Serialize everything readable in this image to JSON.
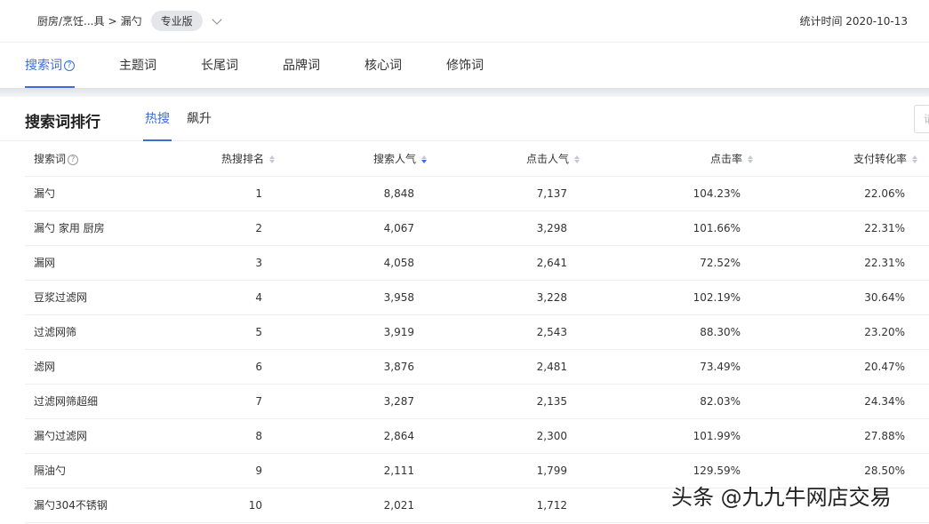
{
  "header": {
    "breadcrumb_category": "厨房/烹饪...具",
    "breadcrumb_sep": ">",
    "breadcrumb_item": "漏勺",
    "badge": "专业版",
    "stat_time": "统计时间 2020-10-13"
  },
  "tabs": [
    {
      "label": "搜索词",
      "active": true,
      "help": "?"
    },
    {
      "label": "主题词"
    },
    {
      "label": "长尾词"
    },
    {
      "label": "品牌词"
    },
    {
      "label": "核心词"
    },
    {
      "label": "修饰词"
    }
  ],
  "ranking": {
    "title": "搜索词排行",
    "subtabs": [
      "热搜",
      "飙升"
    ],
    "search_placeholder": "请"
  },
  "table": {
    "columns": [
      "搜索词",
      "热搜排名",
      "搜索人气",
      "点击人气",
      "点击率",
      "支付转化率"
    ],
    "column_help": "?",
    "rows": [
      [
        "漏勺",
        "1",
        "8,848",
        "7,137",
        "104.23%",
        "22.06%"
      ],
      [
        "漏勺 家用 厨房",
        "2",
        "4,067",
        "3,298",
        "101.66%",
        "22.31%"
      ],
      [
        "漏网",
        "3",
        "4,058",
        "2,641",
        "72.52%",
        "22.31%"
      ],
      [
        "豆浆过滤网",
        "4",
        "3,958",
        "3,228",
        "102.19%",
        "30.64%"
      ],
      [
        "过滤网筛",
        "5",
        "3,919",
        "2,543",
        "88.30%",
        "23.20%"
      ],
      [
        "滤网",
        "6",
        "3,876",
        "2,481",
        "73.49%",
        "20.47%"
      ],
      [
        "过滤网筛超细",
        "7",
        "3,287",
        "2,135",
        "82.03%",
        "24.34%"
      ],
      [
        "漏勺过滤网",
        "8",
        "2,864",
        "2,300",
        "101.99%",
        "27.88%"
      ],
      [
        "隔油勺",
        "9",
        "2,111",
        "1,799",
        "129.59%",
        "28.50%"
      ],
      [
        "漏勺304不锈钢",
        "10",
        "2,021",
        "1,712",
        "",
        ""
      ]
    ]
  },
  "watermark": "头条 @九九牛网店交易",
  "colors": {
    "accent": "#3d6dd6",
    "divider": "#eceef1"
  }
}
